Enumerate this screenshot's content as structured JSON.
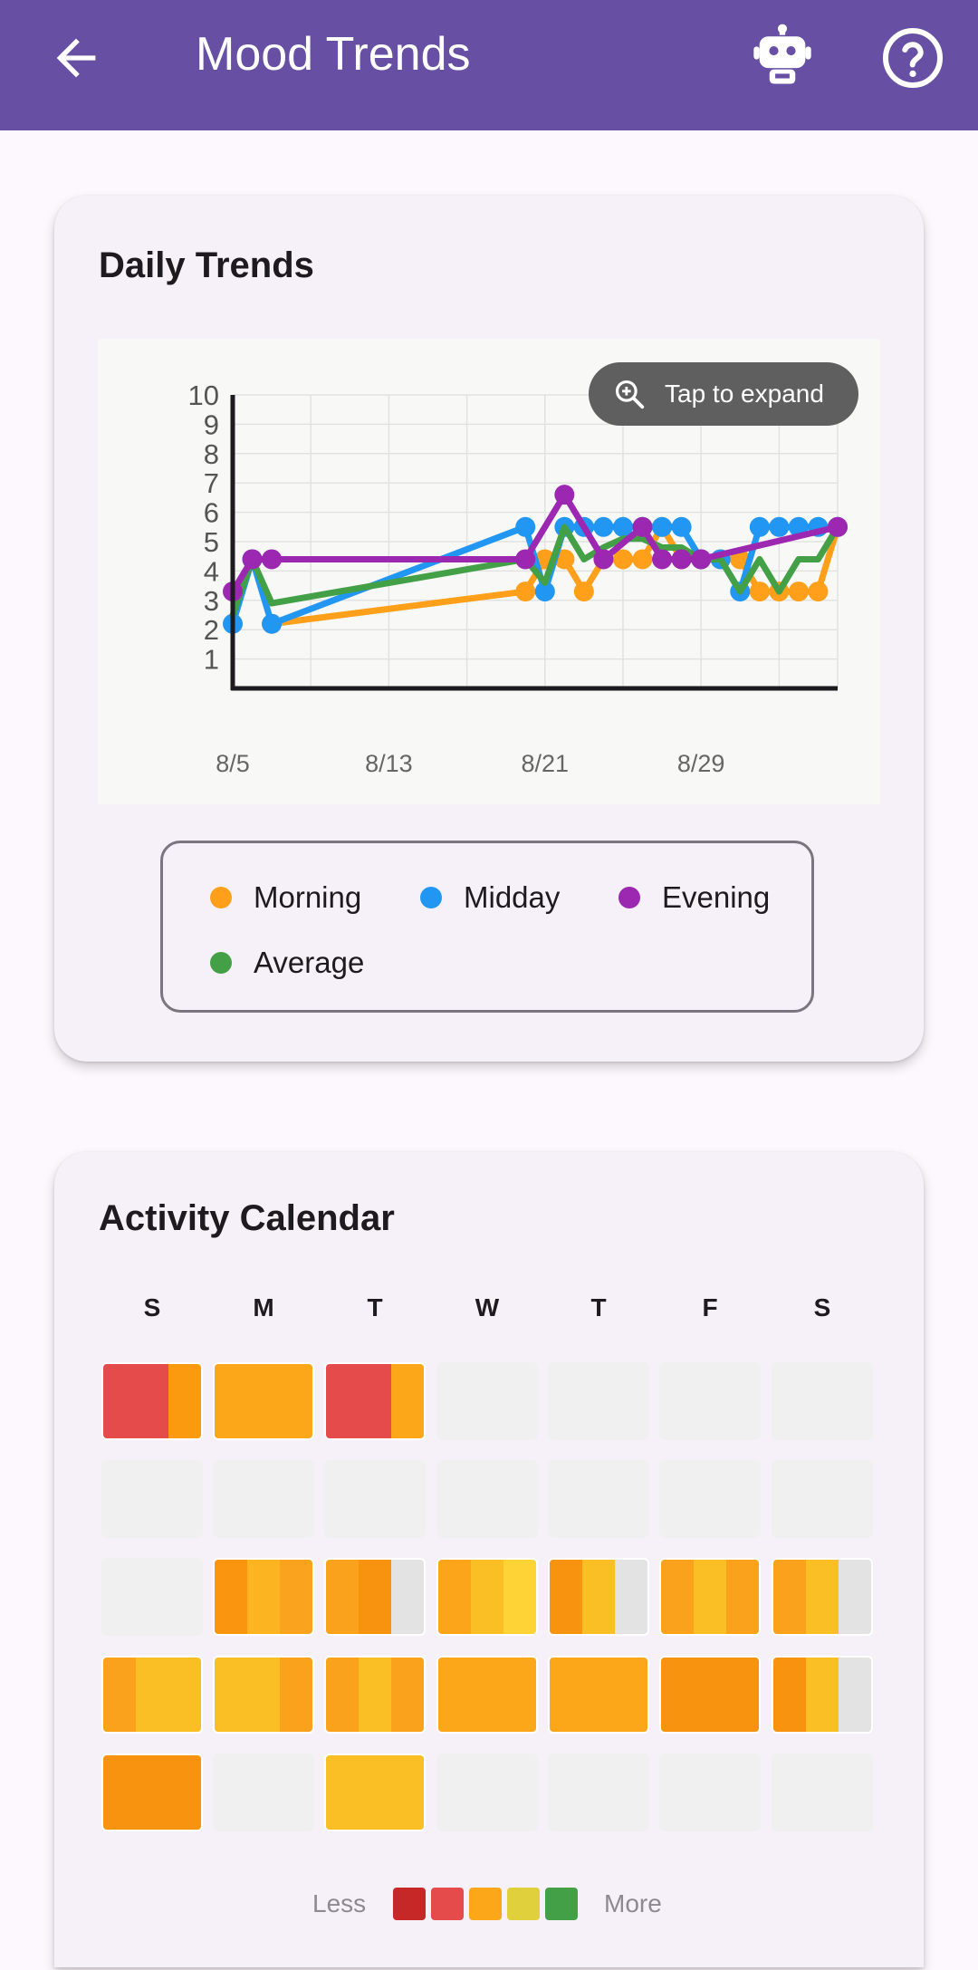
{
  "app_bar": {
    "title": "Mood Trends",
    "background": "#6750a4",
    "icons": [
      "arrow-back-icon",
      "robot-icon",
      "help-circle-icon"
    ]
  },
  "daily_trends": {
    "title": "Daily Trends",
    "expand_label": "Tap to expand",
    "legend": [
      {
        "name": "Morning",
        "color": "#ff9f1a"
      },
      {
        "name": "Midday",
        "color": "#2196f3"
      },
      {
        "name": "Evening",
        "color": "#9c27b0"
      },
      {
        "name": "Average",
        "color": "#43a047"
      }
    ]
  },
  "chart_data": {
    "type": "line",
    "xlabel": "",
    "ylabel": "",
    "x_ticks": [
      "8/5",
      "8/13",
      "8/21",
      "8/29"
    ],
    "x_range": [
      "8/5",
      "9/5"
    ],
    "ylim": [
      0,
      10
    ],
    "y_ticks": [
      1,
      2,
      3,
      4,
      5,
      6,
      7,
      8,
      9,
      10
    ],
    "grid": true,
    "series": [
      {
        "name": "Morning",
        "color": "#ff9f1a",
        "x": [
          "8/7",
          "8/20",
          "8/21",
          "8/22",
          "8/23",
          "8/24",
          "8/25",
          "8/26",
          "8/27",
          "8/28",
          "8/29",
          "8/30",
          "8/31",
          "9/1",
          "9/2",
          "9/3",
          "9/4",
          "9/5"
        ],
        "y": [
          2.2,
          3.3,
          4.4,
          4.4,
          3.3,
          4.4,
          4.4,
          4.4,
          5.5,
          4.4,
          4.4,
          4.4,
          4.4,
          3.3,
          3.3,
          3.3,
          3.3,
          5.5
        ]
      },
      {
        "name": "Midday",
        "color": "#2196f3",
        "x": [
          "8/5",
          "8/6",
          "8/7",
          "8/20",
          "8/21",
          "8/22",
          "8/23",
          "8/24",
          "8/25",
          "8/26",
          "8/27",
          "8/28",
          "8/29",
          "8/30",
          "8/31",
          "9/1",
          "9/2",
          "9/3",
          "9/4",
          "9/5"
        ],
        "y": [
          2.2,
          4.4,
          2.2,
          5.5,
          3.3,
          5.5,
          5.5,
          5.5,
          5.5,
          5.5,
          5.5,
          5.5,
          4.4,
          4.4,
          3.3,
          5.5,
          5.5,
          5.5,
          5.5,
          5.5
        ]
      },
      {
        "name": "Evening",
        "color": "#9c27b0",
        "x": [
          "8/5",
          "8/6",
          "8/7",
          "8/20",
          "8/22",
          "8/24",
          "8/26",
          "8/27",
          "8/28",
          "8/29",
          "9/5"
        ],
        "y": [
          3.3,
          4.4,
          4.4,
          4.4,
          6.6,
          4.4,
          5.5,
          4.4,
          4.4,
          4.4,
          5.5
        ]
      },
      {
        "name": "Average",
        "color": "#43a047",
        "x": [
          "8/5",
          "8/6",
          "8/7",
          "8/20",
          "8/21",
          "8/22",
          "8/23",
          "8/24",
          "8/25",
          "8/26",
          "8/27",
          "8/28",
          "8/29",
          "8/30",
          "8/31",
          "9/1",
          "9/2",
          "9/3",
          "9/4",
          "9/5"
        ],
        "y": [
          2.5,
          4.4,
          2.9,
          4.4,
          3.6,
          5.5,
          4.4,
          4.8,
          5.1,
          5.1,
          4.8,
          4.8,
          4.4,
          4.4,
          3.3,
          4.4,
          3.3,
          4.4,
          4.4,
          5.5
        ]
      }
    ]
  },
  "activity_calendar": {
    "title": "Activity Calendar",
    "weekdays": [
      "S",
      "M",
      "T",
      "W",
      "T",
      "F",
      "S"
    ],
    "rows": [
      [
        [
          "#e54b4b",
          "#e54b4b",
          "#fb9a0e"
        ],
        [
          "#fca719"
        ],
        [
          "#e54b4b",
          "#e54b4b",
          "#fca719"
        ],
        [],
        [],
        [],
        []
      ],
      [
        [],
        [],
        [],
        [],
        [],
        [],
        []
      ],
      [
        [],
        [
          "#f9950f",
          "#fcb520",
          "#faa31e"
        ],
        [
          "#faa21b",
          "#f7930e",
          "#e3e3e3"
        ],
        [
          "#fca41a",
          "#fbbf26",
          "#fdd335"
        ],
        [
          "#f7930e",
          "#fbbf26",
          "#e3e3e3"
        ],
        [
          "#faa21b",
          "#fbbf26",
          "#faa21b"
        ],
        [
          "#faa21b",
          "#fbbf26",
          "#e3e3e3"
        ]
      ],
      [
        [
          "#faa21b",
          "#fbbf26",
          "#fbbf26"
        ],
        [
          "#fbbf26",
          "#fbbf26",
          "#faa21b"
        ],
        [
          "#faa21b",
          "#fbbf26",
          "#faa21b"
        ],
        [
          "#fca719"
        ],
        [
          "#fca719"
        ],
        [
          "#f7930e"
        ],
        [
          "#f7930e",
          "#fbbf26",
          "#e3e3e3"
        ]
      ],
      [
        [
          "#f7930e"
        ],
        [],
        [
          "#fbbf26"
        ],
        [],
        [],
        [],
        []
      ]
    ],
    "scale": {
      "less_label": "Less",
      "more_label": "More",
      "colors": [
        "#c62828",
        "#e54b4b",
        "#fca719",
        "#e0d03c",
        "#43a047"
      ]
    }
  }
}
